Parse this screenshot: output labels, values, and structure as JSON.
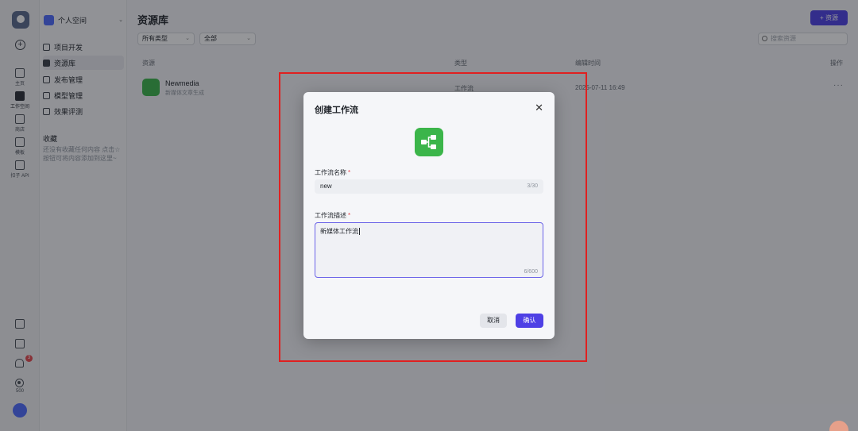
{
  "rail": {
    "items": [
      {
        "label": "主页"
      },
      {
        "label": "工作空间"
      },
      {
        "label": "商店"
      },
      {
        "label": "模板"
      },
      {
        "label": "扣子 API"
      }
    ],
    "notification_count": "3",
    "points": "500"
  },
  "sidebar": {
    "workspace": "个人空间",
    "items": [
      {
        "label": "项目开发"
      },
      {
        "label": "资源库"
      },
      {
        "label": "发布管理"
      },
      {
        "label": "模型管理"
      },
      {
        "label": "效果评测"
      }
    ],
    "favorites_title": "收藏",
    "favorites_empty": "还没有收藏任何内容 点击☆按钮可将内容添加到这里~"
  },
  "main": {
    "title": "资源库",
    "add_button": "+ 资源",
    "filters": {
      "type": "所有类型",
      "scope": "全部"
    },
    "search_placeholder": "搜索资源",
    "columns": {
      "resource": "资源",
      "type": "类型",
      "edit_time": "编辑时间",
      "actions": "操作"
    },
    "rows": [
      {
        "name": "Newmedia",
        "desc": "新媒体文章生成",
        "type": "工作流",
        "time": "2025-07-11 16:49"
      }
    ]
  },
  "modal": {
    "title": "创建工作流",
    "name_label": "工作流名称",
    "name_value": "new",
    "name_count": "3/30",
    "desc_label": "工作流描述",
    "desc_value": "新媒体工作流",
    "desc_count": "6/600",
    "cancel": "取消",
    "confirm": "确认"
  },
  "colors": {
    "accent": "#4e40e5",
    "workflow_green": "#3bb54a",
    "highlight_box": "#e02020"
  }
}
